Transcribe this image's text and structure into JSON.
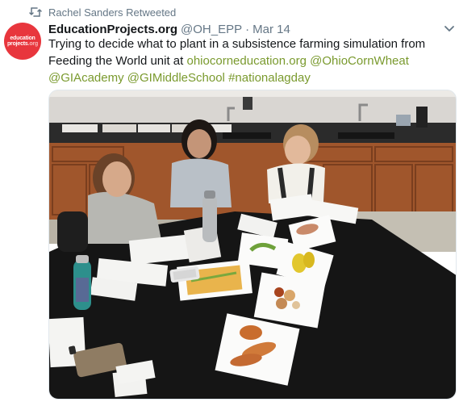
{
  "retweet": {
    "icon": "retweet-icon",
    "label": "Rachel Sanders Retweeted"
  },
  "tweet": {
    "avatar": {
      "line1": "education",
      "line2_a": "projects",
      "line2_b": ".org"
    },
    "display_name": "EducationProjects.org",
    "handle": "@OH_EPP",
    "separator": "·",
    "date": "Mar 14",
    "caret_icon": "chevron-down-icon",
    "text_plain_1": "Trying to decide what to plant in a subsistence farming simulation from Feeding the World unit at ",
    "link_1": "ohiocorneducation.org",
    "link_2": "@OhioCornWheat",
    "link_3": "@GIAcademy",
    "link_4": "@GIMiddleSchool",
    "link_5": "#nationalagday"
  },
  "colors": {
    "link": "#7a9a2e",
    "muted": "#657786",
    "avatar_bg": "#e8363d"
  }
}
